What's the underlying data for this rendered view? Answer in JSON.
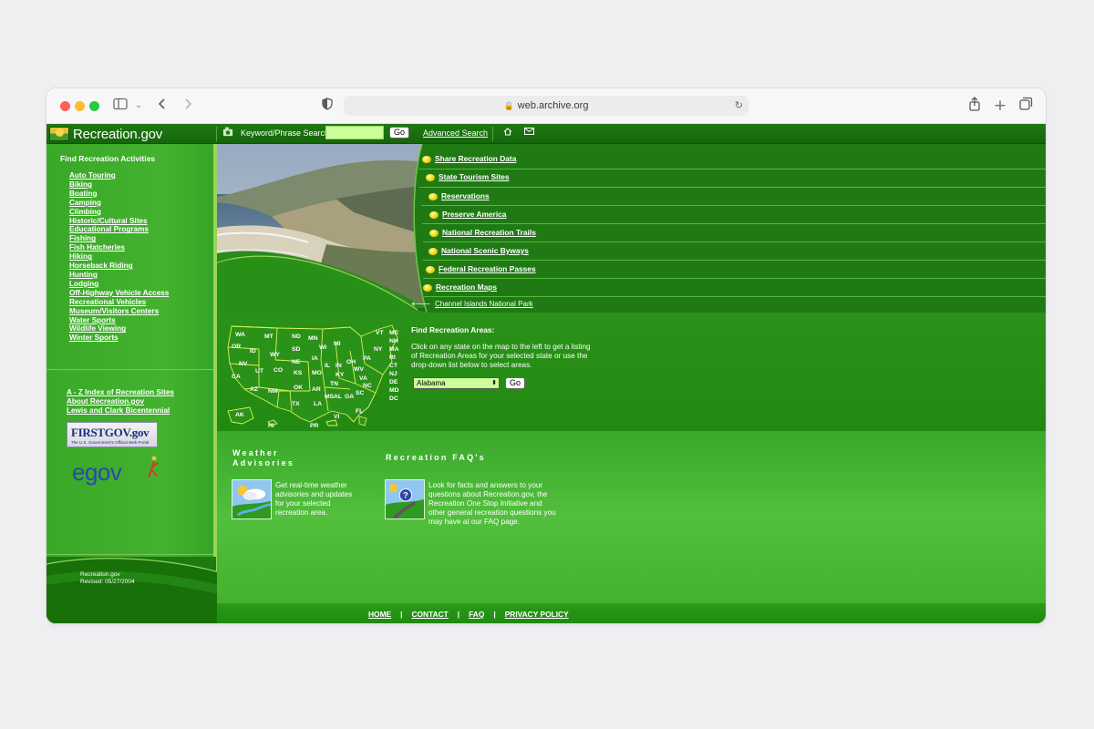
{
  "browser": {
    "url": "web.archive.org"
  },
  "header": {
    "logo_text": "Recreation.gov",
    "search_label": "Keyword/Phrase Search",
    "search_value": "",
    "go_label": "Go",
    "advanced_search": "Advanced Search"
  },
  "sidebar": {
    "heading": "Find Recreation Activities",
    "activities": [
      "Auto Touring",
      "Biking",
      "Boating",
      "Camping",
      "Climbing",
      "Historic/Cultural Sites",
      "Educational Programs",
      "Fishing",
      "Fish Hatcheries",
      "Hiking",
      "Horseback Riding",
      "Hunting",
      "Lodging",
      "Off-Highway Vehicle Access",
      "Recreational Vehicles",
      "Museum/Visitors Centers",
      "Water Sports",
      "Wildlife Viewing",
      "Winter Sports"
    ],
    "links": [
      "A - Z Index of Recreation Sites",
      "About Recreation.gov",
      "Lewis and Clark Bicentennial"
    ],
    "firstgov_logo": "FIRSTGOV.gov",
    "firstgov_sub": "The U.S. Government's Official Web Portal",
    "egov_logo": "egov",
    "site_name": "Recreation.gov",
    "revised": "Revised: 05/27/2004"
  },
  "hero": {
    "links": [
      "Share Recreation Data",
      "State Tourism Sites",
      "Reservations",
      "Preserve America",
      "National Recreation Trails",
      "National Scenic Byways",
      "Federal Recreation Passes",
      "Recreation Maps"
    ],
    "photo_caption": "Channel Islands National Park"
  },
  "find": {
    "title": "Find Recreation Areas:",
    "description": "Click on any state on the map to the left to get a listing of Recreation Areas for your selected state or use the drop-down list below to select areas.",
    "selected_state": "Alabama",
    "go_label": "Go",
    "map_states": [
      "WA",
      "MT",
      "ND",
      "MN",
      "OR",
      "ID",
      "SD",
      "WI",
      "MI",
      "WY",
      "NE",
      "IA",
      "NV",
      "UT",
      "CO",
      "KS",
      "MO",
      "IL",
      "IN",
      "OH",
      "CA",
      "AZ",
      "NM",
      "OK",
      "AR",
      "TN",
      "KY",
      "WV",
      "VA",
      "PA",
      "NY",
      "VT",
      "TX",
      "LA",
      "MS",
      "AL",
      "GA",
      "SC",
      "NC",
      "FL",
      "AK",
      "HI",
      "PR",
      "VI"
    ],
    "east_states": [
      "ME",
      "NH",
      "MA",
      "RI",
      "CT",
      "NJ",
      "DE",
      "MD",
      "DC"
    ]
  },
  "weather": {
    "title_line1": "Weather",
    "title_line2": "Advisories",
    "text": "Get real-time weather advisories and updates for your selected recreation area."
  },
  "faq": {
    "title": "Recreation FAQ's",
    "text": "Look for facts and answers to your questions about Recreation.gov, the Recreation One Stop Initiative and other general recreation questions you may have at our FAQ page."
  },
  "footer": {
    "links": [
      "HOME",
      "CONTACT",
      "FAQ",
      "PRIVACY POLICY"
    ],
    "separator": "|"
  }
}
